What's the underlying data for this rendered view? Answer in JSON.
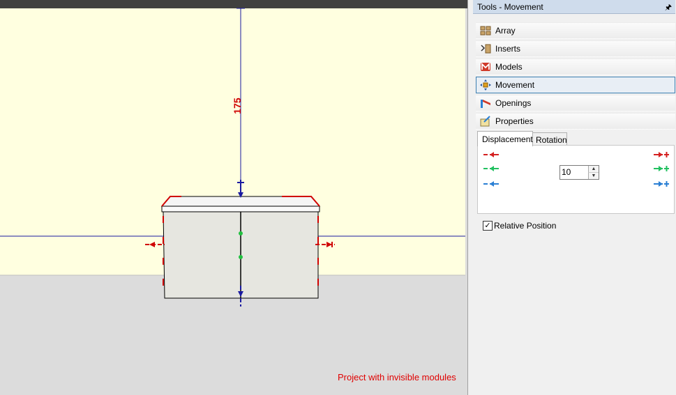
{
  "panel": {
    "title": "Tools - Movement",
    "pin_icon": "pin-icon",
    "tools": [
      {
        "label": "Array",
        "icon": "array-icon"
      },
      {
        "label": "Inserts",
        "icon": "inserts-icon"
      },
      {
        "label": "Models",
        "icon": "models-icon"
      },
      {
        "label": "Movement",
        "icon": "movement-icon",
        "active": true
      },
      {
        "label": "Openings",
        "icon": "openings-icon"
      },
      {
        "label": "Properties",
        "icon": "properties-icon"
      }
    ],
    "tabs": [
      "Displacement",
      "Rotation"
    ],
    "selected_tab": "Displacement",
    "displacement_value": "10",
    "relative_position_label": "Relative Position",
    "relative_position_checked": true,
    "axis_colors": {
      "x": "#d42020",
      "y": "#22c060",
      "z": "#2a7fd4"
    }
  },
  "viewport": {
    "dimension_label": "175",
    "warning": "Project with invisible modules",
    "wall_color": "#ffffe0",
    "floor_color": "#dcdcdc"
  }
}
